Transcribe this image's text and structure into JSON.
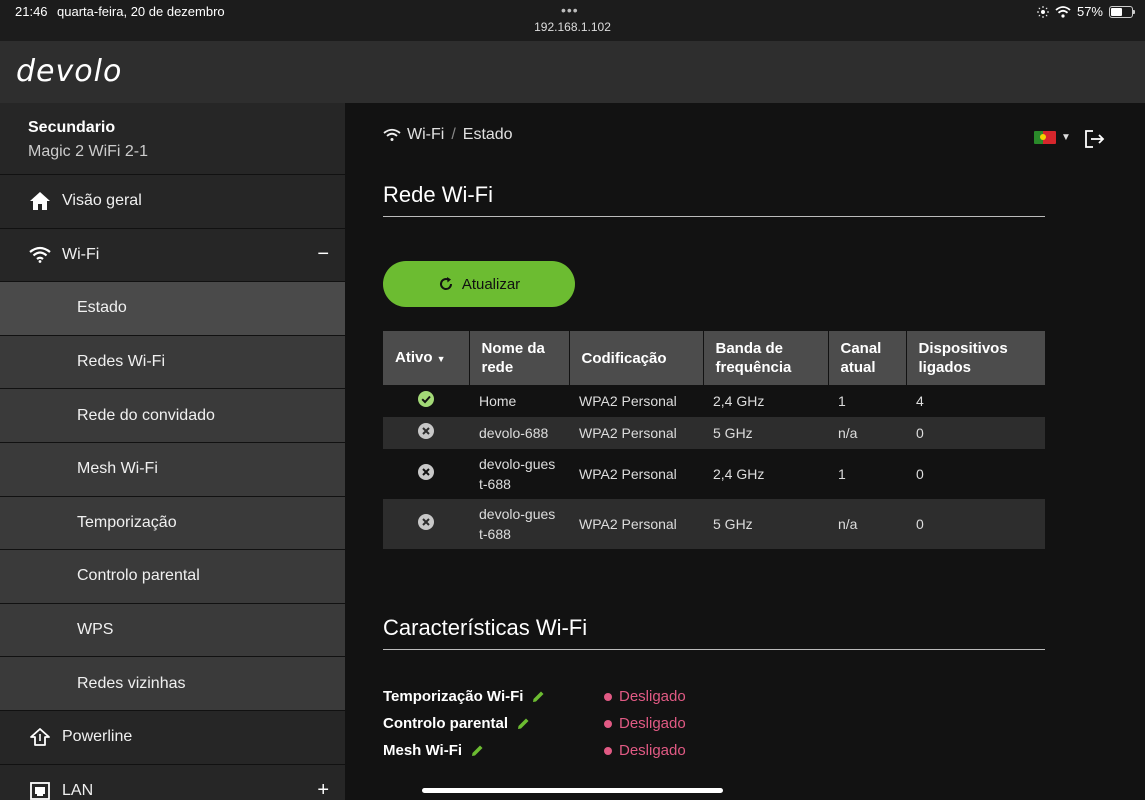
{
  "status_bar": {
    "time": "21:46",
    "date": "quarta-feira, 20 de dezembro",
    "url": "192.168.1.102",
    "battery": "57%",
    "battery_level": 0.57
  },
  "brand": {
    "logo": "devolo",
    "accent": "#6cbc31"
  },
  "device": {
    "name": "Secundario",
    "model": "Magic 2 WiFi 2-1"
  },
  "sidebar": {
    "items": [
      {
        "label": "Visão geral",
        "icon": "home-icon"
      },
      {
        "label": "Wi-Fi",
        "icon": "wifi-icon",
        "toggle": "−"
      },
      {
        "label": "Estado"
      },
      {
        "label": "Redes Wi-Fi"
      },
      {
        "label": "Rede do convidado"
      },
      {
        "label": "Mesh Wi-Fi"
      },
      {
        "label": "Temporização"
      },
      {
        "label": "Controlo parental"
      },
      {
        "label": "WPS"
      },
      {
        "label": "Redes vizinhas"
      },
      {
        "label": "Powerline",
        "icon": "powerline-icon"
      },
      {
        "label": "LAN",
        "icon": "lan-icon",
        "toggle": "+"
      }
    ]
  },
  "breadcrumb": {
    "section": "Wi-Fi",
    "page": "Estado",
    "separator": "/"
  },
  "wifi_network": {
    "title": "Rede Wi-Fi",
    "refresh_label": "Atualizar",
    "columns": [
      "Ativo",
      "Nome da rede",
      "Codificação",
      "Banda de frequência",
      "Canal atual",
      "Dispositivos ligados"
    ],
    "rows": [
      {
        "active": true,
        "name": "Home",
        "encryption": "WPA2 Personal",
        "band": "2,4 GHz",
        "channel": "1",
        "devices": "4"
      },
      {
        "active": false,
        "name": "devolo-688",
        "encryption": "WPA2 Personal",
        "band": "5 GHz",
        "channel": "n/a",
        "devices": "0"
      },
      {
        "active": false,
        "name": "devolo-guest-688",
        "encryption": "WPA2 Personal",
        "band": "2,4 GHz",
        "channel": "1",
        "devices": "0"
      },
      {
        "active": false,
        "name": "devolo-guest-688",
        "encryption": "WPA2 Personal",
        "band": "5 GHz",
        "channel": "n/a",
        "devices": "0"
      }
    ]
  },
  "features": {
    "title": "Características Wi-Fi",
    "items": [
      {
        "label": "Temporização Wi-Fi",
        "status": "Desligado"
      },
      {
        "label": "Controlo parental",
        "status": "Desligado"
      },
      {
        "label": "Mesh Wi-Fi",
        "status": "Desligado"
      }
    ],
    "status_color": "#e15a84"
  }
}
